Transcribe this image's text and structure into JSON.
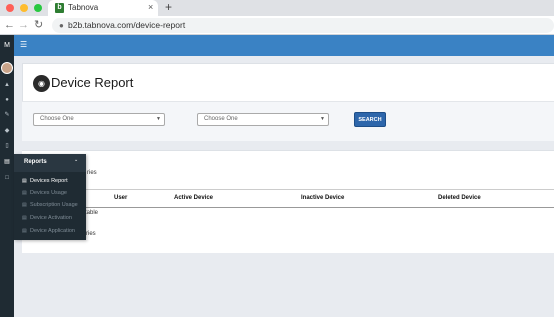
{
  "browser": {
    "tab_title": "Tabnova",
    "tab_favicon": "b",
    "tab_close": "×",
    "new_tab": "+",
    "url": "b2b.tabnova.com/device-report"
  },
  "app": {
    "brand": "M",
    "sidebar_icons": [
      "home-icon",
      "user-icon",
      "edit-icon",
      "tag-icon",
      "mobile-icon",
      "chart-icon",
      "document-icon"
    ]
  },
  "page": {
    "title": "Device Report"
  },
  "filters": {
    "select1_value": "Choose One",
    "select2_value": "Choose One",
    "search_label": "SEARCH"
  },
  "table": {
    "entries_top": "ries",
    "columns": [
      "User",
      "Active Device",
      "Inactive Device",
      "Deleted Device"
    ],
    "empty_message": "n table",
    "entries_bottom": "ries"
  },
  "reports_menu": {
    "title": "Reports",
    "items": [
      {
        "label": "Devices Report",
        "active": true
      },
      {
        "label": "Devices Usage",
        "active": false
      },
      {
        "label": "Subscription Usage",
        "active": false
      },
      {
        "label": "Device Activation",
        "active": false
      },
      {
        "label": "Device Application",
        "active": false
      }
    ]
  },
  "colors": {
    "topbar": "#3a82c4",
    "sidebar": "#1f2b33",
    "search_button": "#2d66ab"
  }
}
